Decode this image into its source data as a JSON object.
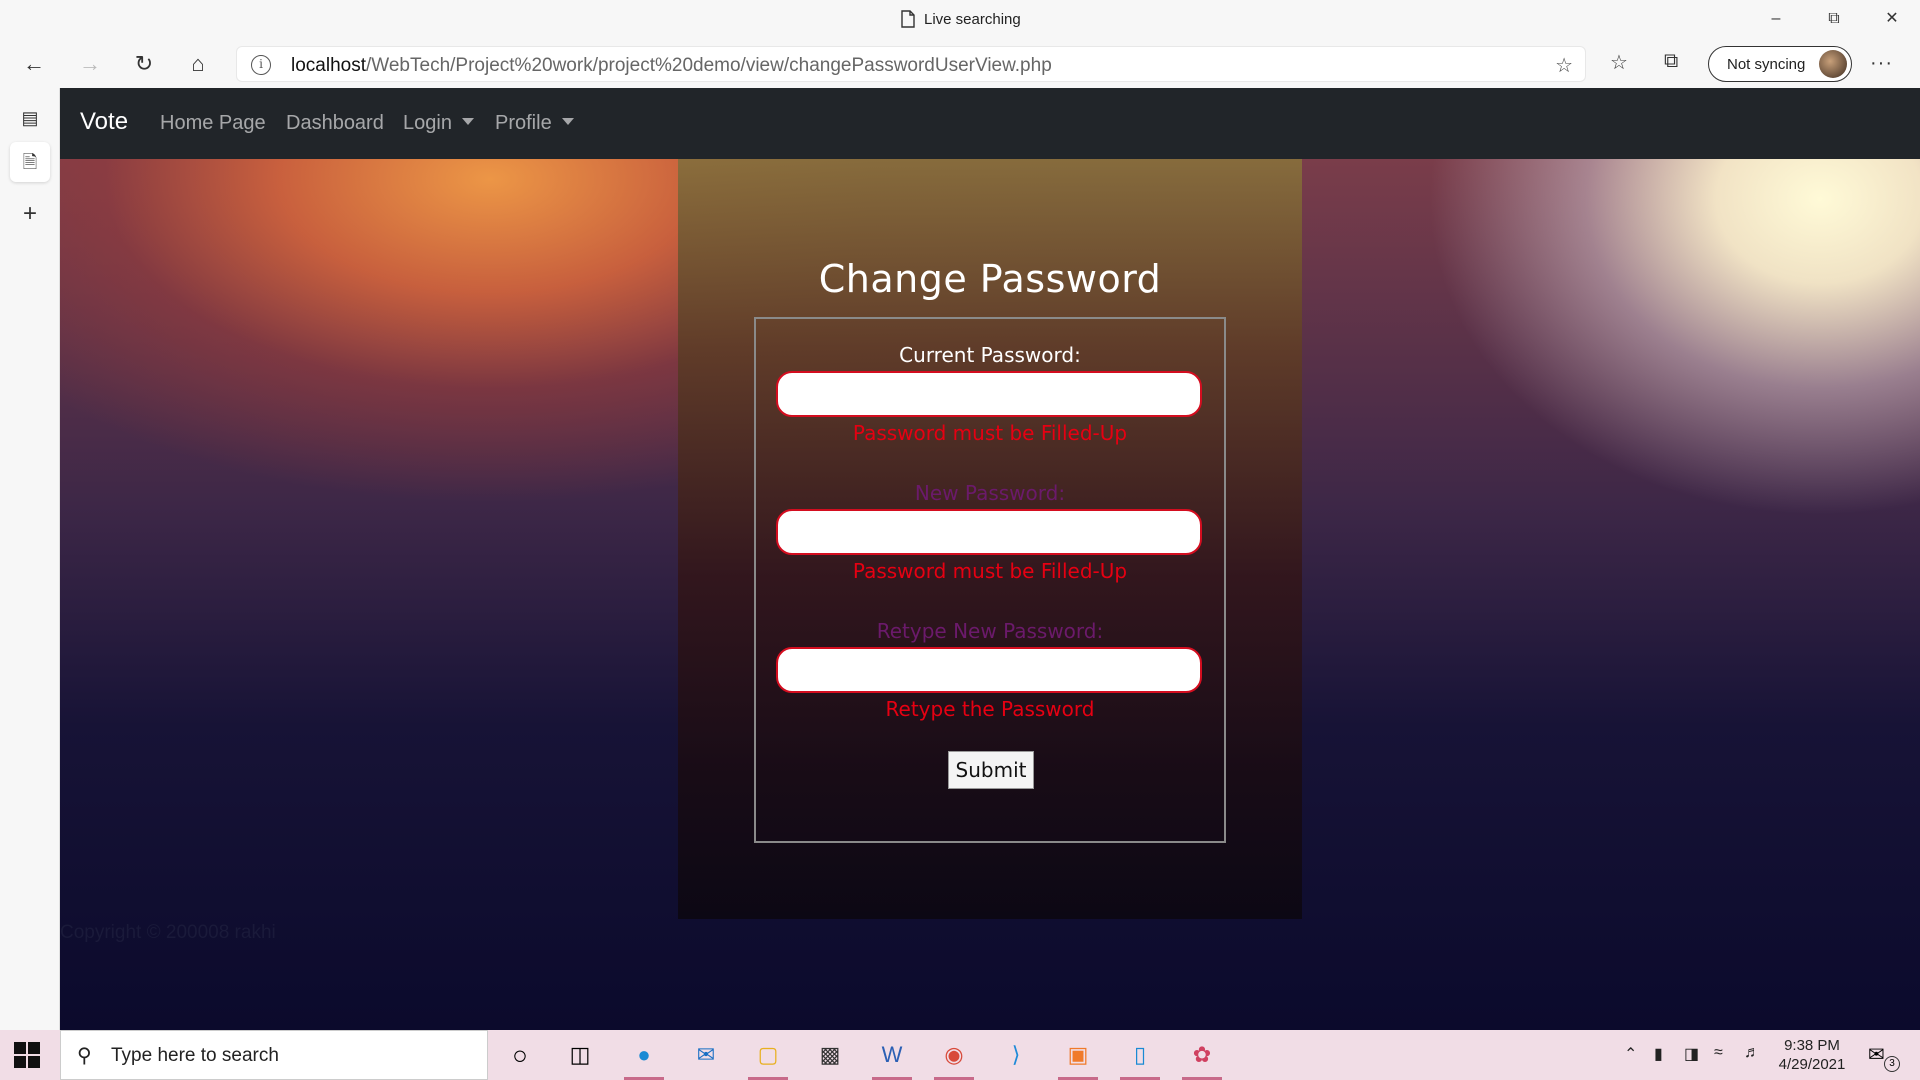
{
  "browser": {
    "tab_title": "Live searching",
    "url_host": "localhost",
    "url_path": "/WebTech/Project%20work/project%20demo/view/changePasswordUserView.php",
    "sync_label": "Not syncing",
    "icons": {
      "back": "back-arrow-icon",
      "forward": "forward-arrow-icon",
      "refresh": "refresh-icon",
      "home": "home-icon",
      "info": "info-icon",
      "favorite_add": "favorite-add-icon",
      "favorites": "favorites-icon",
      "collections": "collections-icon",
      "more": "more-icon"
    }
  },
  "site_nav": {
    "brand": "Vote",
    "links": [
      "Home Page",
      "Dashboard"
    ],
    "dropdowns": [
      "Login",
      "Profile"
    ]
  },
  "form": {
    "title": "Change Password",
    "fields": [
      {
        "label": "Current Password:",
        "error": "Password must be Filled-Up",
        "value": ""
      },
      {
        "label": "New Password:",
        "error": "Password must be Filled-Up",
        "value": ""
      },
      {
        "label": "Retype New Password:",
        "error": "Retype the Password",
        "value": ""
      }
    ],
    "submit_label": "Submit",
    "colors": {
      "error": "#e60012",
      "input_border": "#d40d1f",
      "label_dim": "#6b1a6b"
    }
  },
  "footer": {
    "copyright": "Copyright © 200008 rakhi"
  },
  "taskbar": {
    "search_placeholder": "Type here to search",
    "time": "9:38 PM",
    "date": "4/29/2021",
    "notification_count": "3"
  }
}
